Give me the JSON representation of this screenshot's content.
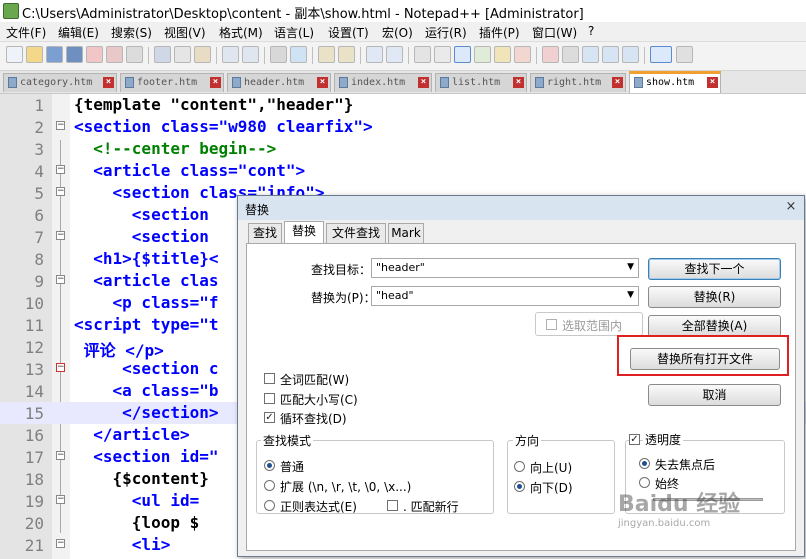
{
  "window": {
    "title": "C:\\Users\\Administrator\\Desktop\\content - 副本\\show.html - Notepad++ [Administrator]"
  },
  "menu": [
    "文件(F)",
    "编辑(E)",
    "搜索(S)",
    "视图(V)",
    "格式(M)",
    "语言(L)",
    "设置(T)",
    "宏(O)",
    "运行(R)",
    "插件(P)",
    "窗口(W)",
    "?"
  ],
  "tabs": [
    {
      "label": "category.htm"
    },
    {
      "label": "footer.htm"
    },
    {
      "label": "header.htm"
    },
    {
      "label": "index.htm"
    },
    {
      "label": "list.htm"
    },
    {
      "label": "right.htm"
    },
    {
      "label": "show.htm",
      "active": true
    }
  ],
  "editor": {
    "lines": [
      {
        "n": "1",
        "text": "{template \"content\",\"header\"}"
      },
      {
        "n": "2",
        "text": "<section class=\"w980 clearfix\">"
      },
      {
        "n": "3",
        "text": "  <!--center begin-->"
      },
      {
        "n": "4",
        "text": "  <article class=\"cont\">"
      },
      {
        "n": "5",
        "text": "    <section class=\"info\">"
      },
      {
        "n": "6",
        "text": "      <section"
      },
      {
        "n": "7",
        "text": "      <section"
      },
      {
        "n": "8",
        "text": "  <h1>{$title}<"
      },
      {
        "n": "9",
        "text": "  <article clas"
      },
      {
        "n": "10",
        "text": "    <p class=\"f"
      },
      {
        "n": "11",
        "text": "<script type=\"t"
      },
      {
        "n": "12",
        "text": " 评论 </p>"
      },
      {
        "n": "13",
        "text": "     <section c"
      },
      {
        "n": "14",
        "text": "    <a class=\"b"
      },
      {
        "n": "15",
        "text": "     </section>"
      },
      {
        "n": "16",
        "text": "  </article>"
      },
      {
        "n": "17",
        "text": "  <section id=\""
      },
      {
        "n": "18",
        "text": "    {$content}"
      },
      {
        "n": "19",
        "text": "      <ul id="
      },
      {
        "n": "20",
        "text": "      {loop $"
      },
      {
        "n": "21",
        "text": "      <li>"
      }
    ]
  },
  "dialog": {
    "title": "替换",
    "close": "×",
    "tabs": [
      "查找",
      "替换",
      "文件查找",
      "Mark"
    ],
    "find_label": "查找目标：",
    "find_value": "\"header\"",
    "replace_label": "替换为(P)：",
    "replace_value": "\"head\"",
    "in_selection": "选取范围内",
    "buttons": {
      "find_next": "查找下一个",
      "replace": "替换(R)",
      "replace_all": "全部替换(A)",
      "replace_all_open": "替换所有打开文件",
      "cancel": "取消"
    },
    "checks": {
      "whole_word": "全词匹配(W)",
      "match_case": "匹配大小写(C)",
      "wrap": "循环查找(D)"
    },
    "search_mode": {
      "title": "查找模式",
      "normal": "普通",
      "extended": "扩展 (\\n, \\r, \\t, \\0, \\x...)",
      "regex": "正则表达式(E)",
      "newline": ". 匹配新行"
    },
    "direction": {
      "title": "方向",
      "up": "向上(U)",
      "down": "向下(D)"
    },
    "transparency": {
      "title": "透明度",
      "on_lose_focus": "失去焦点后",
      "always": "始终"
    }
  },
  "watermark": "Baidu 经验",
  "overlay_text": "jingyan.baidu.com"
}
